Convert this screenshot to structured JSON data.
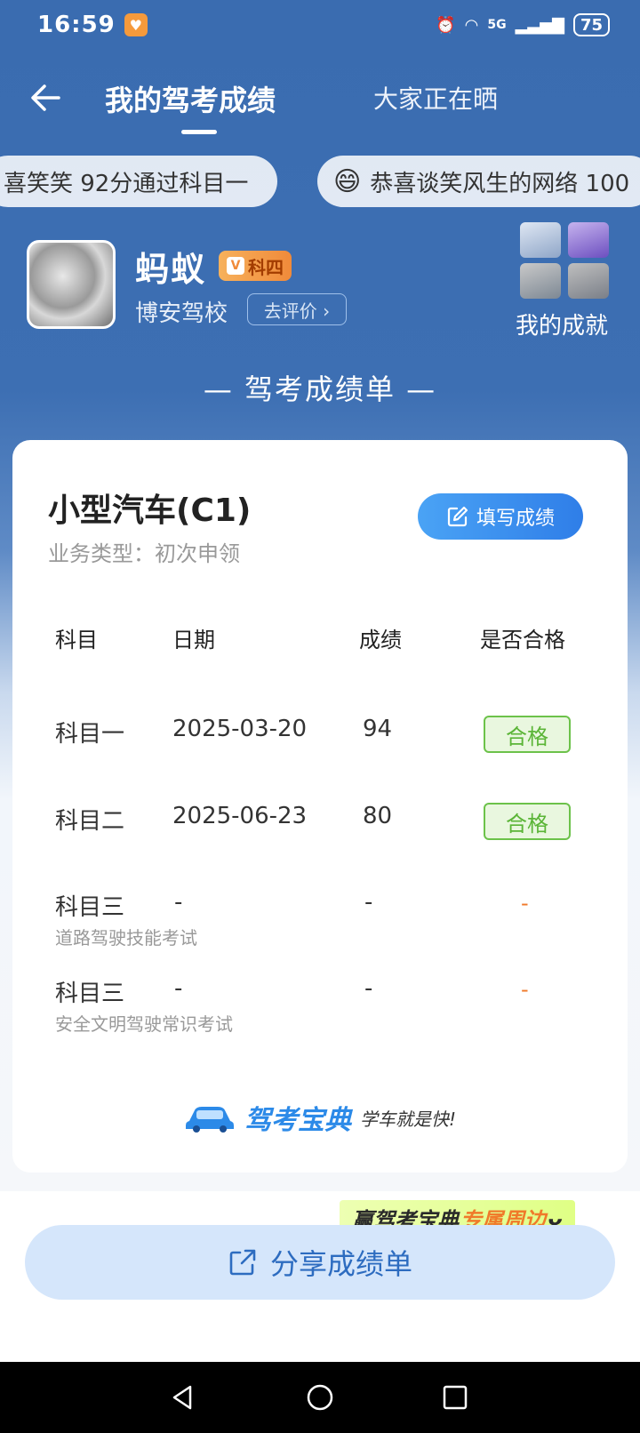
{
  "status_bar": {
    "time": "16:59",
    "network": "5G",
    "battery": "75"
  },
  "nav": {
    "tab_mine": "我的驾考成绩",
    "tab_others": "大家正在晒"
  },
  "ticker": [
    "喜笑笑 92分通过科目一",
    "恭喜谈笑风生的网络 100"
  ],
  "profile": {
    "name": "蚂蚁",
    "level": "科四",
    "school": "博安驾校",
    "rate_button": "去评价 ›",
    "achievement_label": "我的成就"
  },
  "sheet_heading": "— 驾考成绩单 —",
  "card": {
    "vehicle": "小型汽车(C1)",
    "business_type": "业务类型：初次申领",
    "fill_button": "填写成绩",
    "headers": {
      "subject": "科目",
      "date": "日期",
      "score": "成绩",
      "passed": "是否合格"
    },
    "rows": [
      {
        "subject": "科目一",
        "date": "2025-03-20",
        "score": "94",
        "status": "合格"
      },
      {
        "subject": "科目二",
        "date": "2025-06-23",
        "score": "80",
        "status": "合格"
      },
      {
        "subject": "科目三",
        "note": "道路驾驶技能考试",
        "date": "-",
        "score": "-",
        "status": "-"
      },
      {
        "subject": "科目三",
        "note": "安全文明驾驶常识考试",
        "date": "-",
        "score": "-",
        "status": "-"
      }
    ],
    "brand_name": "驾考宝典",
    "brand_slogan": "学车就是快!"
  },
  "promo": {
    "prefix": "赢驾考宝典",
    "accent": "专属周边"
  },
  "share_button": "分享成绩单",
  "colors": {
    "header_blue": "#3a6cb0",
    "pass_green": "#5bb537",
    "accent_orange": "#f07a2a",
    "button_blue": "#2f7ee8"
  }
}
